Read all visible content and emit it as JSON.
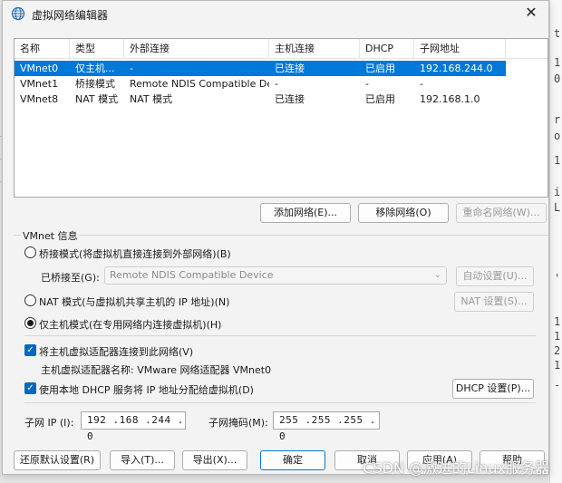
{
  "window": {
    "title": "虚拟网络编辑器",
    "close_glyph": "✕"
  },
  "table": {
    "headers": [
      "名称",
      "类型",
      "外部连接",
      "主机连接",
      "DHCP",
      "子网地址"
    ],
    "rows": [
      {
        "name": "VMnet0",
        "type": "仅主机...",
        "external": "-",
        "host": "已连接",
        "dhcp": "已启用",
        "subnet": "192.168.244.0",
        "selected": true
      },
      {
        "name": "VMnet1",
        "type": "桥接模式",
        "external": "Remote NDIS Compatible De...",
        "host": "-",
        "dhcp": "-",
        "subnet": "-",
        "selected": false
      },
      {
        "name": "VMnet8",
        "type": "NAT 模式",
        "external": "NAT 模式",
        "host": "已连接",
        "dhcp": "已启用",
        "subnet": "192.168.1.0",
        "selected": false
      }
    ]
  },
  "list_buttons": {
    "add": "添加网络(E)...",
    "remove": "移除网络(O)",
    "rename": "重命名网络(W)..."
  },
  "vmnet_info": {
    "group_label": "VMnet 信息",
    "bridge_radio": "桥接模式(将虚拟机直接连接到外部网络)(B)",
    "bridged_to_label": "已桥接至(G):",
    "bridged_to_value": "Remote NDIS Compatible Device",
    "auto_settings": "自动设置(U)...",
    "nat_radio": "NAT 模式(与虚拟机共享主机的 IP 地址)(N)",
    "nat_settings": "NAT 设置(S)...",
    "hostonly_radio": "仅主机模式(在专用网络内连接虚拟机)(H)",
    "connect_adapter_check": "将主机虚拟适配器连接到此网络(V)",
    "adapter_name_text": "主机虚拟适配器名称: VMware 网络适配器 VMnet0",
    "dhcp_check": "使用本地 DHCP 服务将 IP 地址分配给虚拟机(D)",
    "dhcp_settings": "DHCP 设置(P)...",
    "subnet_ip_label": "子网 IP (I):",
    "subnet_ip_value": "192 .168 .244 . 0",
    "subnet_mask_label": "子网掩码(M):",
    "subnet_mask_value": "255 .255 .255 . 0"
  },
  "footer_buttons": {
    "restore": "还原默认设置(R)",
    "import": "导入(T)...",
    "export": "导出(X)...",
    "ok": "确定",
    "cancel": "取消",
    "apply": "应用(A)",
    "help": "帮助"
  },
  "watermark": "CSDN @激进的Linux服务器",
  "background_right_chars": [
    "t",
    "1",
    "0",
    "r",
    "o",
    "1",
    "i",
    "L",
    "'",
    "1",
    "1",
    "2",
    "1",
    "-"
  ],
  "colors": {
    "selection": "#0078d7",
    "checkbox": "#0067c0",
    "window_bg": "#f3f3f3"
  }
}
